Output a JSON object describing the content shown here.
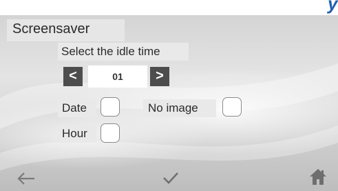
{
  "header": {
    "cut_title": "y"
  },
  "screen": {
    "title": "Screensaver",
    "idle_label": "Select the idle time",
    "idle_value": "01",
    "prev_glyph": "<",
    "next_glyph": ">",
    "options": {
      "date_label": "Date",
      "no_image_label": "No image",
      "hour_label": "Hour",
      "date_checked": false,
      "no_image_checked": false,
      "hour_checked": false
    }
  },
  "footer": {
    "back_icon": "arrow-left-icon",
    "confirm_icon": "checkmark-icon",
    "home_icon": "home-icon"
  },
  "colors": {
    "header_accent": "#1f5fb0",
    "button_dark": "#4d4d4d",
    "icon_gray": "#7a7a7a"
  }
}
